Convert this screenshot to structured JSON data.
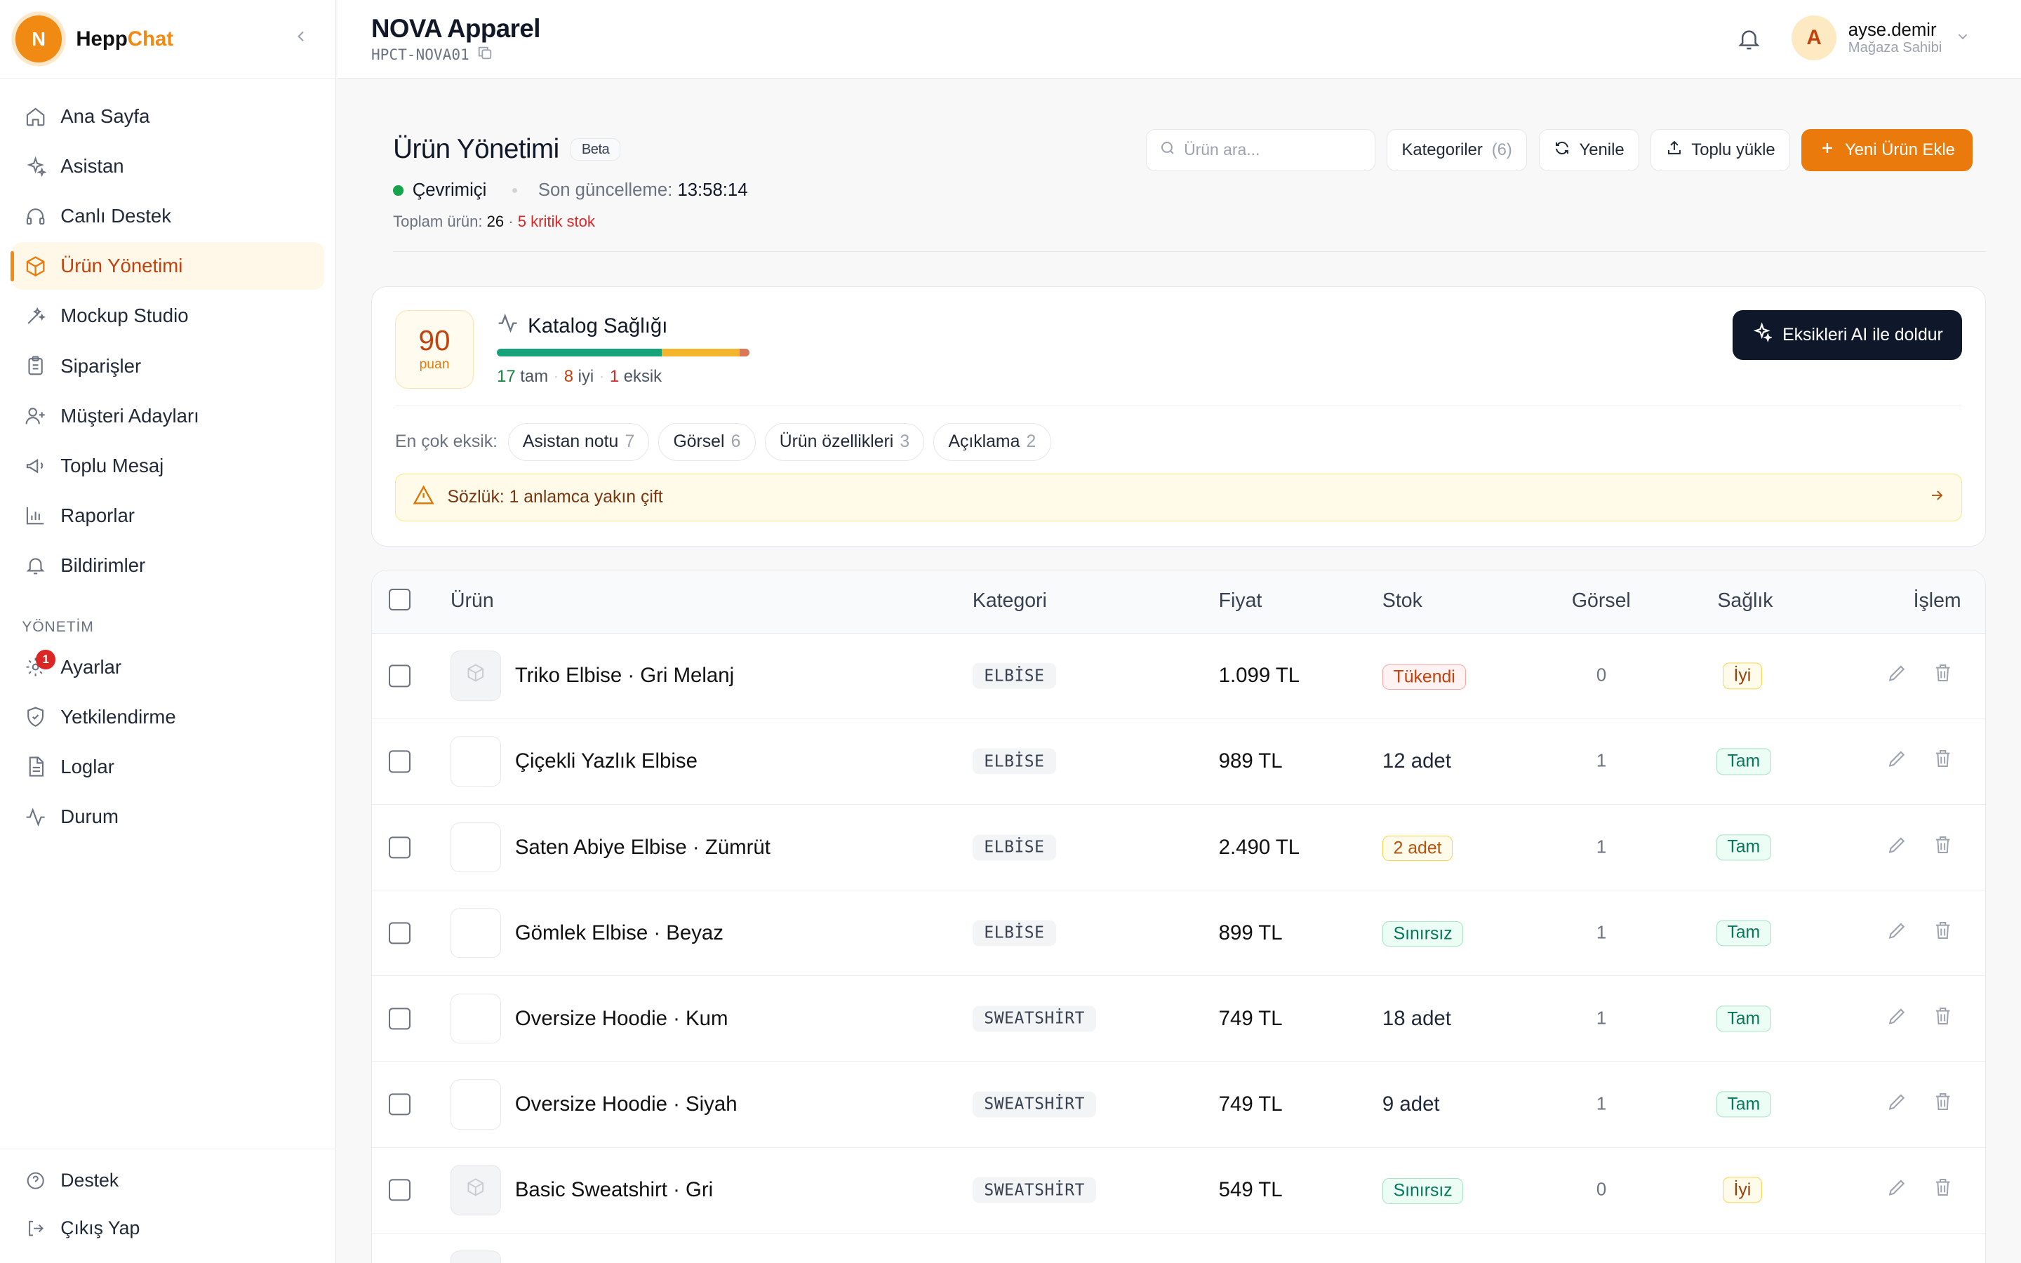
{
  "brand": {
    "initial": "N",
    "name_a": "Hepp",
    "name_b": "Chat"
  },
  "nav": [
    {
      "label": "Ana Sayfa",
      "icon": "home-icon"
    },
    {
      "label": "Asistan",
      "icon": "sparkles-icon"
    },
    {
      "label": "Canlı Destek",
      "icon": "headset-icon"
    },
    {
      "label": "Ürün Yönetimi",
      "icon": "box-icon",
      "active": true
    },
    {
      "label": "Mockup Studio",
      "icon": "wand-icon"
    },
    {
      "label": "Siparişler",
      "icon": "clipboard-icon"
    },
    {
      "label": "Müşteri Adayları",
      "icon": "user-plus-icon"
    },
    {
      "label": "Toplu Mesaj",
      "icon": "megaphone-icon"
    },
    {
      "label": "Raporlar",
      "icon": "bar-chart-icon"
    },
    {
      "label": "Bildirimler",
      "icon": "bell-icon"
    }
  ],
  "admin": {
    "section_label": "YÖNETİM",
    "items": [
      {
        "label": "Ayarlar",
        "icon": "gear-icon",
        "badge": "1"
      },
      {
        "label": "Yetkilendirme",
        "icon": "shield-icon"
      },
      {
        "label": "Loglar",
        "icon": "file-icon"
      },
      {
        "label": "Durum",
        "icon": "activity-icon"
      }
    ]
  },
  "bottom": [
    {
      "label": "Destek",
      "icon": "help-circle-icon"
    },
    {
      "label": "Çıkış Yap",
      "icon": "logout-icon"
    }
  ],
  "topbar": {
    "store_name": "NOVA Apparel",
    "store_code": "HPCT-NOVA01",
    "user_initial": "A",
    "user_name": "ayse.demir",
    "user_role": "Mağaza Sahibi"
  },
  "page": {
    "title": "Ürün Yönetimi",
    "beta": "Beta",
    "status": "Çevrimiçi",
    "last_update_label": "Son güncelleme:",
    "last_update_time": "13:58:14",
    "total_label": "Toplam ürün:",
    "total_value": "26",
    "separator": "·",
    "critical": "5 kritik stok"
  },
  "actions": {
    "search_placeholder": "Ürün ara...",
    "categories_label": "Kategoriler",
    "categories_count": "(6)",
    "refresh": "Yenile",
    "bulk_upload": "Toplu yükle",
    "new_product": "Yeni Ürün Ekle"
  },
  "health": {
    "score": 90,
    "score_unit": "puan",
    "title": "Katalog Sağlığı",
    "full_count": 17,
    "full_label": "tam",
    "good_count": 8,
    "good_label": "iyi",
    "missing_count": 1,
    "missing_label": "eksik",
    "fill_ai": "Eksikleri AI ile doldur",
    "missing_label_prefix": "En çok eksik:",
    "chips": [
      {
        "label": "Asistan notu",
        "count": "7"
      },
      {
        "label": "Görsel",
        "count": "6"
      },
      {
        "label": "Ürün özellikleri",
        "count": "3"
      },
      {
        "label": "Açıklama",
        "count": "2"
      }
    ],
    "warning": "Sözlük: 1 anlamca yakın çift"
  },
  "table": {
    "headers": {
      "product": "Ürün",
      "category": "Kategori",
      "price": "Fiyat",
      "stock": "Stok",
      "image": "Görsel",
      "health": "Sağlık",
      "action": "İşlem"
    },
    "rows": [
      {
        "name": "Triko Elbise · Gri Melanj",
        "category": "ELBİSE",
        "price": "1.099 TL",
        "stock": "Tükendi",
        "stock_style": "red",
        "images": "0",
        "health": "İyi",
        "health_style": "iyi",
        "thumb": "empty"
      },
      {
        "name": "Çiçekli Yazlık Elbise",
        "category": "ELBİSE",
        "price": "989 TL",
        "stock": "12 adet",
        "stock_style": "plain",
        "images": "1",
        "health": "Tam",
        "health_style": "green",
        "thumb": "image"
      },
      {
        "name": "Saten Abiye Elbise · Zümrüt",
        "category": "ELBİSE",
        "price": "2.490 TL",
        "stock": "2 adet",
        "stock_style": "amber",
        "images": "1",
        "health": "Tam",
        "health_style": "green",
        "thumb": "image"
      },
      {
        "name": "Gömlek Elbise · Beyaz",
        "category": "ELBİSE",
        "price": "899 TL",
        "stock": "Sınırsız",
        "stock_style": "green",
        "images": "1",
        "health": "Tam",
        "health_style": "green",
        "thumb": "image"
      },
      {
        "name": "Oversize Hoodie · Kum",
        "category": "SWEATSHİRT",
        "price": "749 TL",
        "stock": "18 adet",
        "stock_style": "plain",
        "images": "1",
        "health": "Tam",
        "health_style": "green",
        "thumb": "image"
      },
      {
        "name": "Oversize Hoodie · Siyah",
        "category": "SWEATSHİRT",
        "price": "749 TL",
        "stock": "9 adet",
        "stock_style": "plain",
        "images": "1",
        "health": "Tam",
        "health_style": "green",
        "thumb": "image"
      },
      {
        "name": "Basic Sweatshirt · Gri",
        "category": "SWEATSHİRT",
        "price": "549 TL",
        "stock": "Sınırsız",
        "stock_style": "green",
        "images": "0",
        "health": "İyi",
        "health_style": "iyi",
        "thumb": "empty"
      },
      {
        "name": "",
        "category": "",
        "price": "",
        "stock": "",
        "stock_style": "plain",
        "images": "",
        "health": "",
        "health_style": "iyi",
        "thumb": "empty"
      }
    ]
  },
  "colors": {
    "accent": "#ea7a0c",
    "success": "#16a34a",
    "danger": "#dc2626",
    "dark": "#0f172a"
  }
}
